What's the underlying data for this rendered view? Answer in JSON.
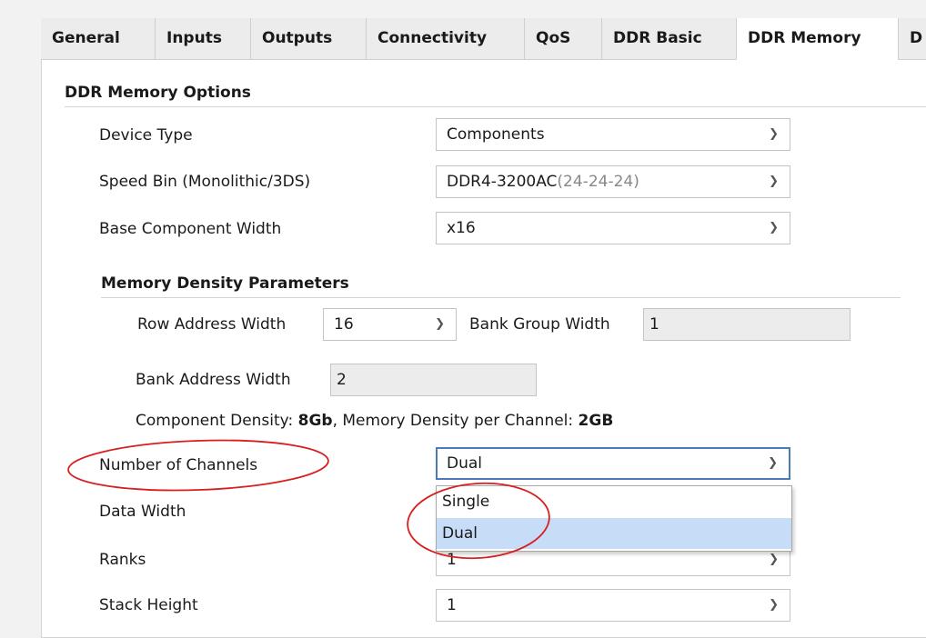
{
  "tabs": [
    {
      "label": "General",
      "active": false
    },
    {
      "label": "Inputs",
      "active": false
    },
    {
      "label": "Outputs",
      "active": false
    },
    {
      "label": "Connectivity",
      "active": false
    },
    {
      "label": "QoS",
      "active": false
    },
    {
      "label": "DDR Basic",
      "active": false
    },
    {
      "label": "DDR Memory",
      "active": true
    },
    {
      "label": "D",
      "active": false
    }
  ],
  "ddr_options": {
    "title": "DDR Memory Options",
    "device_type": {
      "label": "Device Type",
      "value": "Components"
    },
    "speed_bin": {
      "label": "Speed Bin (Monolithic/3DS)",
      "value_main": "DDR4-3200AC",
      "value_timing": "(24-24-24)"
    },
    "base_width": {
      "label": "Base Component Width",
      "value": "x16"
    }
  },
  "density": {
    "title": "Memory Density Parameters",
    "row_address": {
      "label": "Row Address Width",
      "value": "16"
    },
    "bank_group": {
      "label": "Bank Group Width",
      "value": "1"
    },
    "bank_address": {
      "label": "Bank Address Width",
      "value": "2"
    },
    "summary": {
      "component_label": "Component Density: ",
      "component_value": "8Gb",
      "channel_label": ", Memory Density per Channel: ",
      "channel_value": "2GB"
    }
  },
  "channels": {
    "label": "Number of Channels",
    "value": "Dual",
    "options": [
      "Single",
      "Dual"
    ],
    "selected": "Dual"
  },
  "data_width": {
    "label": "Data Width"
  },
  "ranks": {
    "label": "Ranks",
    "value": "1"
  },
  "stack_height": {
    "label": "Stack Height",
    "value": "1"
  },
  "colors": {
    "accent": "#4a7ab8",
    "selection": "#c7ddf7",
    "annotation": "#d81f1f"
  }
}
